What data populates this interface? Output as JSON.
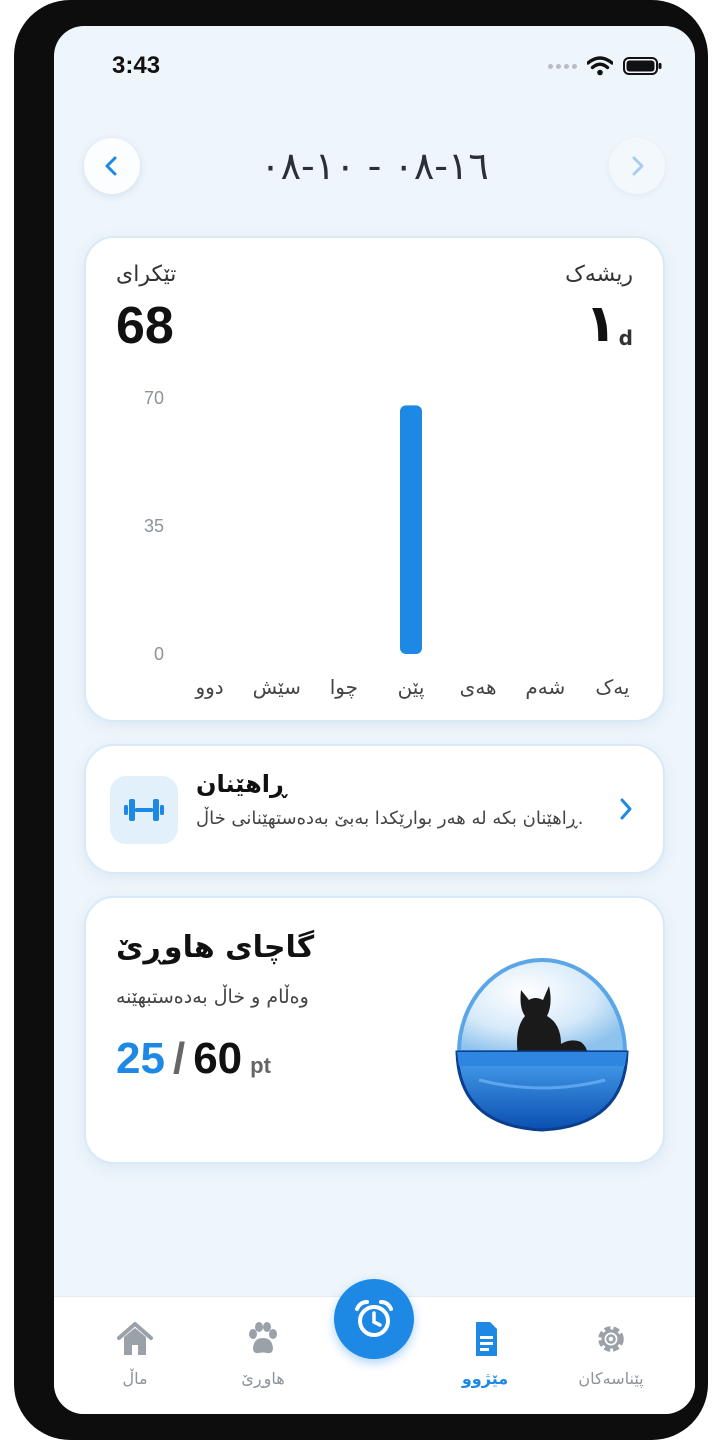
{
  "status_bar": {
    "time": "3:43"
  },
  "header": {
    "date_range": "١٦-٠٨ - ١٠-٠٨"
  },
  "stats": {
    "left_label": "تێکرای",
    "left_value": "68",
    "right_label": "ریشەک",
    "right_value": "١",
    "right_unit": "d"
  },
  "chart_data": {
    "type": "bar",
    "categories": [
      "دوو",
      "سێش",
      "چوا",
      "پێن",
      "هەی",
      "شەم",
      "یەک"
    ],
    "values": [
      0,
      0,
      0,
      68,
      0,
      0,
      0
    ],
    "ylim": [
      0,
      70
    ],
    "yticks": [
      "70",
      "35",
      "0"
    ],
    "xlabel": "",
    "ylabel": "",
    "colors": {
      "bar": "#1e88e5"
    },
    "grid": false
  },
  "training": {
    "title": "ڕاهێنان",
    "description": "ڕاهێنان بکە لە هەر بوارێکدا بەبێ بەدەستهێنانی خاڵ.",
    "icon": "dumbbell-icon"
  },
  "pet": {
    "title": "گاچای هاوڕێ",
    "subtitle": "وەڵام و خاڵ بەدەستبهێنە",
    "current": "25",
    "separator": "/",
    "max": "60",
    "unit": "pt"
  },
  "tabs": [
    {
      "label": "ماڵ",
      "icon": "home-icon"
    },
    {
      "label": "هاوڕێ",
      "icon": "paw-icon"
    },
    {
      "label": "مێژوو",
      "icon": "document-icon",
      "active": true
    },
    {
      "label": "پێناسەکان",
      "icon": "gear-icon"
    }
  ],
  "colors": {
    "accent": "#1e88e5",
    "background": "#eef5fb"
  }
}
